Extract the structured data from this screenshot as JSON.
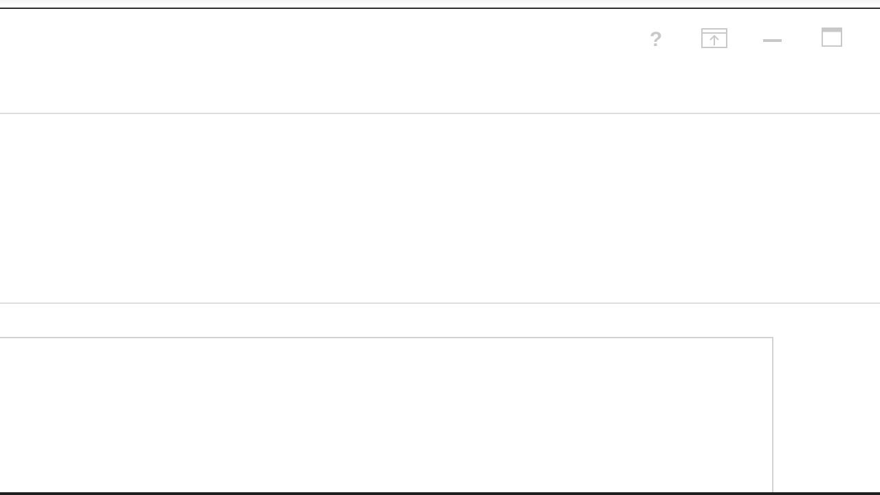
{
  "window": {
    "title": "",
    "controls": [
      {
        "name": "help",
        "icon": "question-mark-icon",
        "label": "?"
      },
      {
        "name": "popout",
        "icon": "popout-icon"
      },
      {
        "name": "minimize",
        "icon": "minimize-icon"
      },
      {
        "name": "maximize",
        "icon": "maximize-icon"
      }
    ]
  },
  "colors": {
    "background": "#ffffff",
    "divider": "#dcdcdc",
    "icon": "#c8c8c8",
    "frame_border": "#d2d2d2",
    "screen_edge": "#1f1f1f"
  }
}
